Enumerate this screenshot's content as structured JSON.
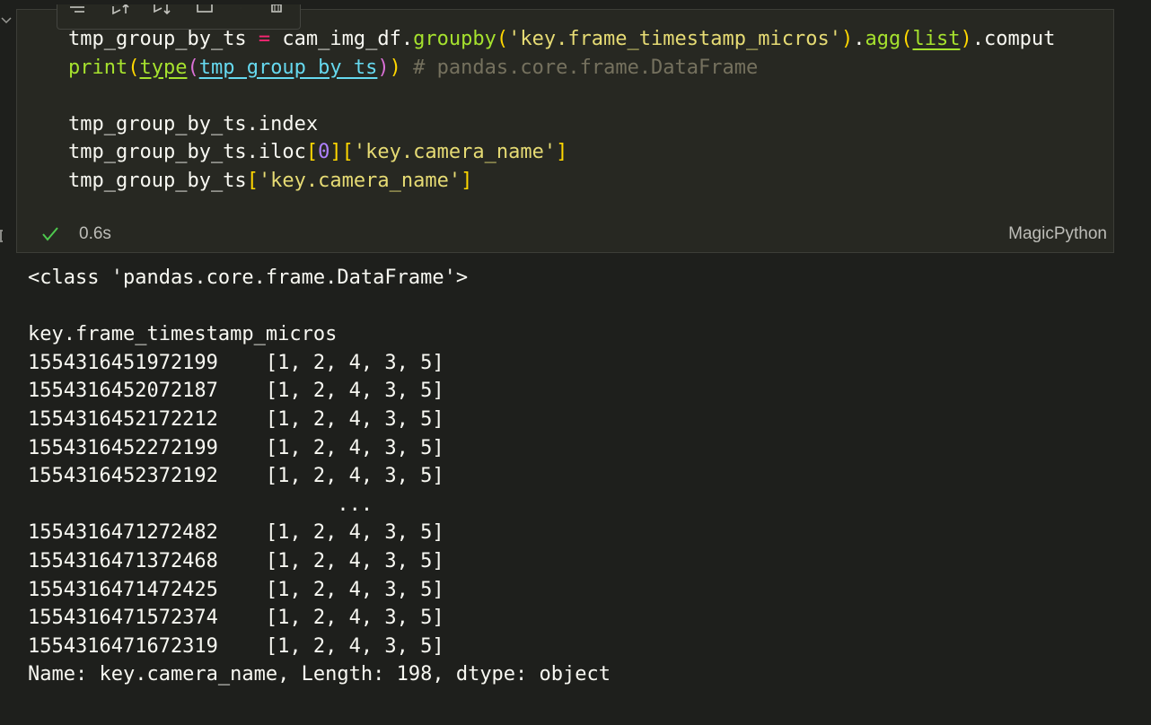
{
  "cell": {
    "code_lines": [
      [
        {
          "t": "tmp_group_by_ts ",
          "c": ""
        },
        {
          "t": "=",
          "c": "tok-op"
        },
        {
          "t": " cam_img_df.",
          "c": ""
        },
        {
          "t": "groupby",
          "c": "tok-fn"
        },
        {
          "t": "(",
          "c": "tok-br1"
        },
        {
          "t": "'key.frame_timestamp_micros'",
          "c": "tok-str"
        },
        {
          "t": ")",
          "c": "tok-br1"
        },
        {
          "t": ".",
          "c": ""
        },
        {
          "t": "agg",
          "c": "tok-fn"
        },
        {
          "t": "(",
          "c": "tok-br1"
        },
        {
          "t": "list",
          "c": "tok-fn-u"
        },
        {
          "t": ")",
          "c": "tok-br1"
        },
        {
          "t": ".comput",
          "c": ""
        }
      ],
      [
        {
          "t": "print",
          "c": "tok-fn"
        },
        {
          "t": "(",
          "c": "tok-br1"
        },
        {
          "t": "type",
          "c": "tok-fn-u"
        },
        {
          "t": "(",
          "c": "tok-br2"
        },
        {
          "t": "tmp_group_by_ts",
          "c": "tok-var-u"
        },
        {
          "t": ")",
          "c": "tok-br2"
        },
        {
          "t": ")",
          "c": "tok-br1"
        },
        {
          "t": " ",
          "c": ""
        },
        {
          "t": "# pandas.core.frame.DataFrame",
          "c": "tok-cm"
        }
      ],
      [],
      [
        {
          "t": "tmp_group_by_ts.index",
          "c": ""
        }
      ],
      [
        {
          "t": "tmp_group_by_ts.iloc",
          "c": ""
        },
        {
          "t": "[",
          "c": "tok-br1"
        },
        {
          "t": "0",
          "c": "tok-num"
        },
        {
          "t": "]",
          "c": "tok-br1"
        },
        {
          "t": "[",
          "c": "tok-br1"
        },
        {
          "t": "'key.camera_name'",
          "c": "tok-str"
        },
        {
          "t": "]",
          "c": "tok-br1"
        }
      ],
      [
        {
          "t": "tmp_group_by_ts",
          "c": ""
        },
        {
          "t": "[",
          "c": "tok-br1"
        },
        {
          "t": "'key.camera_name'",
          "c": "tok-str"
        },
        {
          "t": "]",
          "c": "tok-br1"
        }
      ]
    ],
    "status": {
      "check_icon": "check-icon",
      "exec_time": "0.6s",
      "kernel": "MagicPython"
    },
    "toolbar_icons": [
      "run-by-line-icon",
      "execute-above-icon",
      "execute-below-icon",
      "split-cell-icon",
      "more-icon",
      "delete-icon"
    ]
  },
  "output": {
    "lines": [
      "<class 'pandas.core.frame.DataFrame'>",
      "",
      "key.frame_timestamp_micros",
      "1554316451972199    [1, 2, 4, 3, 5]",
      "1554316452072187    [1, 2, 4, 3, 5]",
      "1554316452172212    [1, 2, 4, 3, 5]",
      "1554316452272199    [1, 2, 4, 3, 5]",
      "1554316452372192    [1, 2, 4, 3, 5]",
      "                          ...",
      "1554316471272482    [1, 2, 4, 3, 5]",
      "1554316471372468    [1, 2, 4, 3, 5]",
      "1554316471472425    [1, 2, 4, 3, 5]",
      "1554316471572374    [1, 2, 4, 3, 5]",
      "1554316471672319    [1, 2, 4, 3, 5]",
      "Name: key.camera_name, Length: 198, dtype: object"
    ]
  },
  "colors": {
    "background": "#1e1f1c",
    "cell_background": "#272822",
    "function": "#a6e22e",
    "string": "#e6db74",
    "operator": "#f92672",
    "number": "#ae81ff",
    "comment": "#75715e",
    "check": "#4ec94e"
  }
}
